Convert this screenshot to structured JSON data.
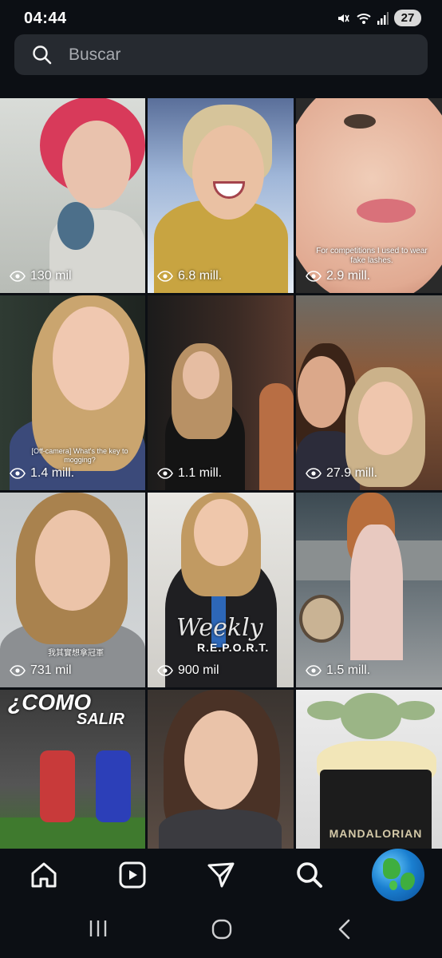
{
  "status_bar": {
    "time": "04:44",
    "battery": "27",
    "icons": [
      "mute-icon",
      "wifi-icon",
      "signal-icon",
      "battery-icon"
    ]
  },
  "search": {
    "placeholder": "Buscar",
    "value": ""
  },
  "grid": {
    "tiles": [
      {
        "views": "130 mil",
        "caption": ""
      },
      {
        "views": "6.8 mill.",
        "caption": ""
      },
      {
        "views": "2.9 mill.",
        "caption": "For competitions I used to wear fake lashes."
      },
      {
        "views": "1.4 mill.",
        "caption": "[Off-camera] What's the key to mogging?"
      },
      {
        "views": "1.1 mill.",
        "caption": ""
      },
      {
        "views": "27.9 mill.",
        "caption": ""
      },
      {
        "views": "731 mil",
        "caption": "我其實想拿冠軍"
      },
      {
        "views": "900 mil",
        "caption": "",
        "overlay_title": "Weekly",
        "overlay_subtitle": "R.E.P.O.R.T."
      },
      {
        "views": "1.5 mill.",
        "caption": ""
      },
      {
        "views": "",
        "caption": "",
        "overlay_title": "¿COMO",
        "overlay_subtitle": "SALIR"
      },
      {
        "views": "",
        "caption": ""
      },
      {
        "views": "",
        "caption": "",
        "overlay_title": "MANDALORIAN"
      }
    ]
  },
  "bottom_nav": {
    "items": [
      "home-icon",
      "reels-icon",
      "send-icon",
      "search-icon",
      "profile-avatar"
    ]
  },
  "system_nav": {
    "items": [
      "recents-icon",
      "home-circle-icon",
      "back-icon"
    ]
  },
  "colors": {
    "background": "#0c0f14",
    "search_bg": "#262a30",
    "placeholder": "#a8abb0",
    "text": "#f5f5f5"
  }
}
